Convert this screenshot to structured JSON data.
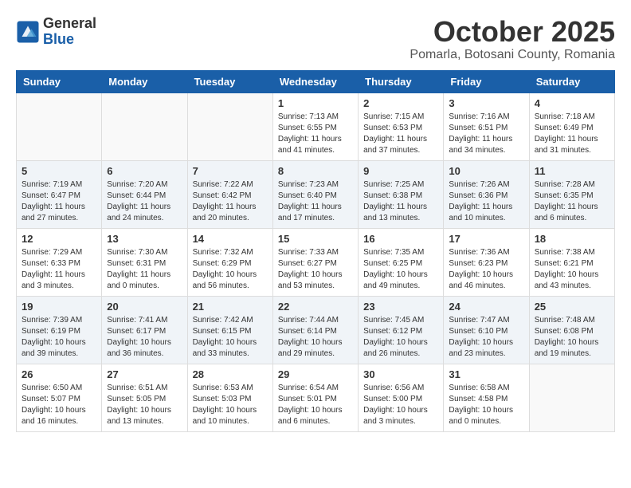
{
  "logo": {
    "general": "General",
    "blue": "Blue"
  },
  "header": {
    "month": "October 2025",
    "location": "Pomarla, Botosani County, Romania"
  },
  "weekdays": [
    "Sunday",
    "Monday",
    "Tuesday",
    "Wednesday",
    "Thursday",
    "Friday",
    "Saturday"
  ],
  "weeks": [
    [
      {
        "day": "",
        "info": ""
      },
      {
        "day": "",
        "info": ""
      },
      {
        "day": "",
        "info": ""
      },
      {
        "day": "1",
        "info": "Sunrise: 7:13 AM\nSunset: 6:55 PM\nDaylight: 11 hours\nand 41 minutes."
      },
      {
        "day": "2",
        "info": "Sunrise: 7:15 AM\nSunset: 6:53 PM\nDaylight: 11 hours\nand 37 minutes."
      },
      {
        "day": "3",
        "info": "Sunrise: 7:16 AM\nSunset: 6:51 PM\nDaylight: 11 hours\nand 34 minutes."
      },
      {
        "day": "4",
        "info": "Sunrise: 7:18 AM\nSunset: 6:49 PM\nDaylight: 11 hours\nand 31 minutes."
      }
    ],
    [
      {
        "day": "5",
        "info": "Sunrise: 7:19 AM\nSunset: 6:47 PM\nDaylight: 11 hours\nand 27 minutes."
      },
      {
        "day": "6",
        "info": "Sunrise: 7:20 AM\nSunset: 6:44 PM\nDaylight: 11 hours\nand 24 minutes."
      },
      {
        "day": "7",
        "info": "Sunrise: 7:22 AM\nSunset: 6:42 PM\nDaylight: 11 hours\nand 20 minutes."
      },
      {
        "day": "8",
        "info": "Sunrise: 7:23 AM\nSunset: 6:40 PM\nDaylight: 11 hours\nand 17 minutes."
      },
      {
        "day": "9",
        "info": "Sunrise: 7:25 AM\nSunset: 6:38 PM\nDaylight: 11 hours\nand 13 minutes."
      },
      {
        "day": "10",
        "info": "Sunrise: 7:26 AM\nSunset: 6:36 PM\nDaylight: 11 hours\nand 10 minutes."
      },
      {
        "day": "11",
        "info": "Sunrise: 7:28 AM\nSunset: 6:35 PM\nDaylight: 11 hours\nand 6 minutes."
      }
    ],
    [
      {
        "day": "12",
        "info": "Sunrise: 7:29 AM\nSunset: 6:33 PM\nDaylight: 11 hours\nand 3 minutes."
      },
      {
        "day": "13",
        "info": "Sunrise: 7:30 AM\nSunset: 6:31 PM\nDaylight: 11 hours\nand 0 minutes."
      },
      {
        "day": "14",
        "info": "Sunrise: 7:32 AM\nSunset: 6:29 PM\nDaylight: 10 hours\nand 56 minutes."
      },
      {
        "day": "15",
        "info": "Sunrise: 7:33 AM\nSunset: 6:27 PM\nDaylight: 10 hours\nand 53 minutes."
      },
      {
        "day": "16",
        "info": "Sunrise: 7:35 AM\nSunset: 6:25 PM\nDaylight: 10 hours\nand 49 minutes."
      },
      {
        "day": "17",
        "info": "Sunrise: 7:36 AM\nSunset: 6:23 PM\nDaylight: 10 hours\nand 46 minutes."
      },
      {
        "day": "18",
        "info": "Sunrise: 7:38 AM\nSunset: 6:21 PM\nDaylight: 10 hours\nand 43 minutes."
      }
    ],
    [
      {
        "day": "19",
        "info": "Sunrise: 7:39 AM\nSunset: 6:19 PM\nDaylight: 10 hours\nand 39 minutes."
      },
      {
        "day": "20",
        "info": "Sunrise: 7:41 AM\nSunset: 6:17 PM\nDaylight: 10 hours\nand 36 minutes."
      },
      {
        "day": "21",
        "info": "Sunrise: 7:42 AM\nSunset: 6:15 PM\nDaylight: 10 hours\nand 33 minutes."
      },
      {
        "day": "22",
        "info": "Sunrise: 7:44 AM\nSunset: 6:14 PM\nDaylight: 10 hours\nand 29 minutes."
      },
      {
        "day": "23",
        "info": "Sunrise: 7:45 AM\nSunset: 6:12 PM\nDaylight: 10 hours\nand 26 minutes."
      },
      {
        "day": "24",
        "info": "Sunrise: 7:47 AM\nSunset: 6:10 PM\nDaylight: 10 hours\nand 23 minutes."
      },
      {
        "day": "25",
        "info": "Sunrise: 7:48 AM\nSunset: 6:08 PM\nDaylight: 10 hours\nand 19 minutes."
      }
    ],
    [
      {
        "day": "26",
        "info": "Sunrise: 6:50 AM\nSunset: 5:07 PM\nDaylight: 10 hours\nand 16 minutes."
      },
      {
        "day": "27",
        "info": "Sunrise: 6:51 AM\nSunset: 5:05 PM\nDaylight: 10 hours\nand 13 minutes."
      },
      {
        "day": "28",
        "info": "Sunrise: 6:53 AM\nSunset: 5:03 PM\nDaylight: 10 hours\nand 10 minutes."
      },
      {
        "day": "29",
        "info": "Sunrise: 6:54 AM\nSunset: 5:01 PM\nDaylight: 10 hours\nand 6 minutes."
      },
      {
        "day": "30",
        "info": "Sunrise: 6:56 AM\nSunset: 5:00 PM\nDaylight: 10 hours\nand 3 minutes."
      },
      {
        "day": "31",
        "info": "Sunrise: 6:58 AM\nSunset: 4:58 PM\nDaylight: 10 hours\nand 0 minutes."
      },
      {
        "day": "",
        "info": ""
      }
    ]
  ]
}
